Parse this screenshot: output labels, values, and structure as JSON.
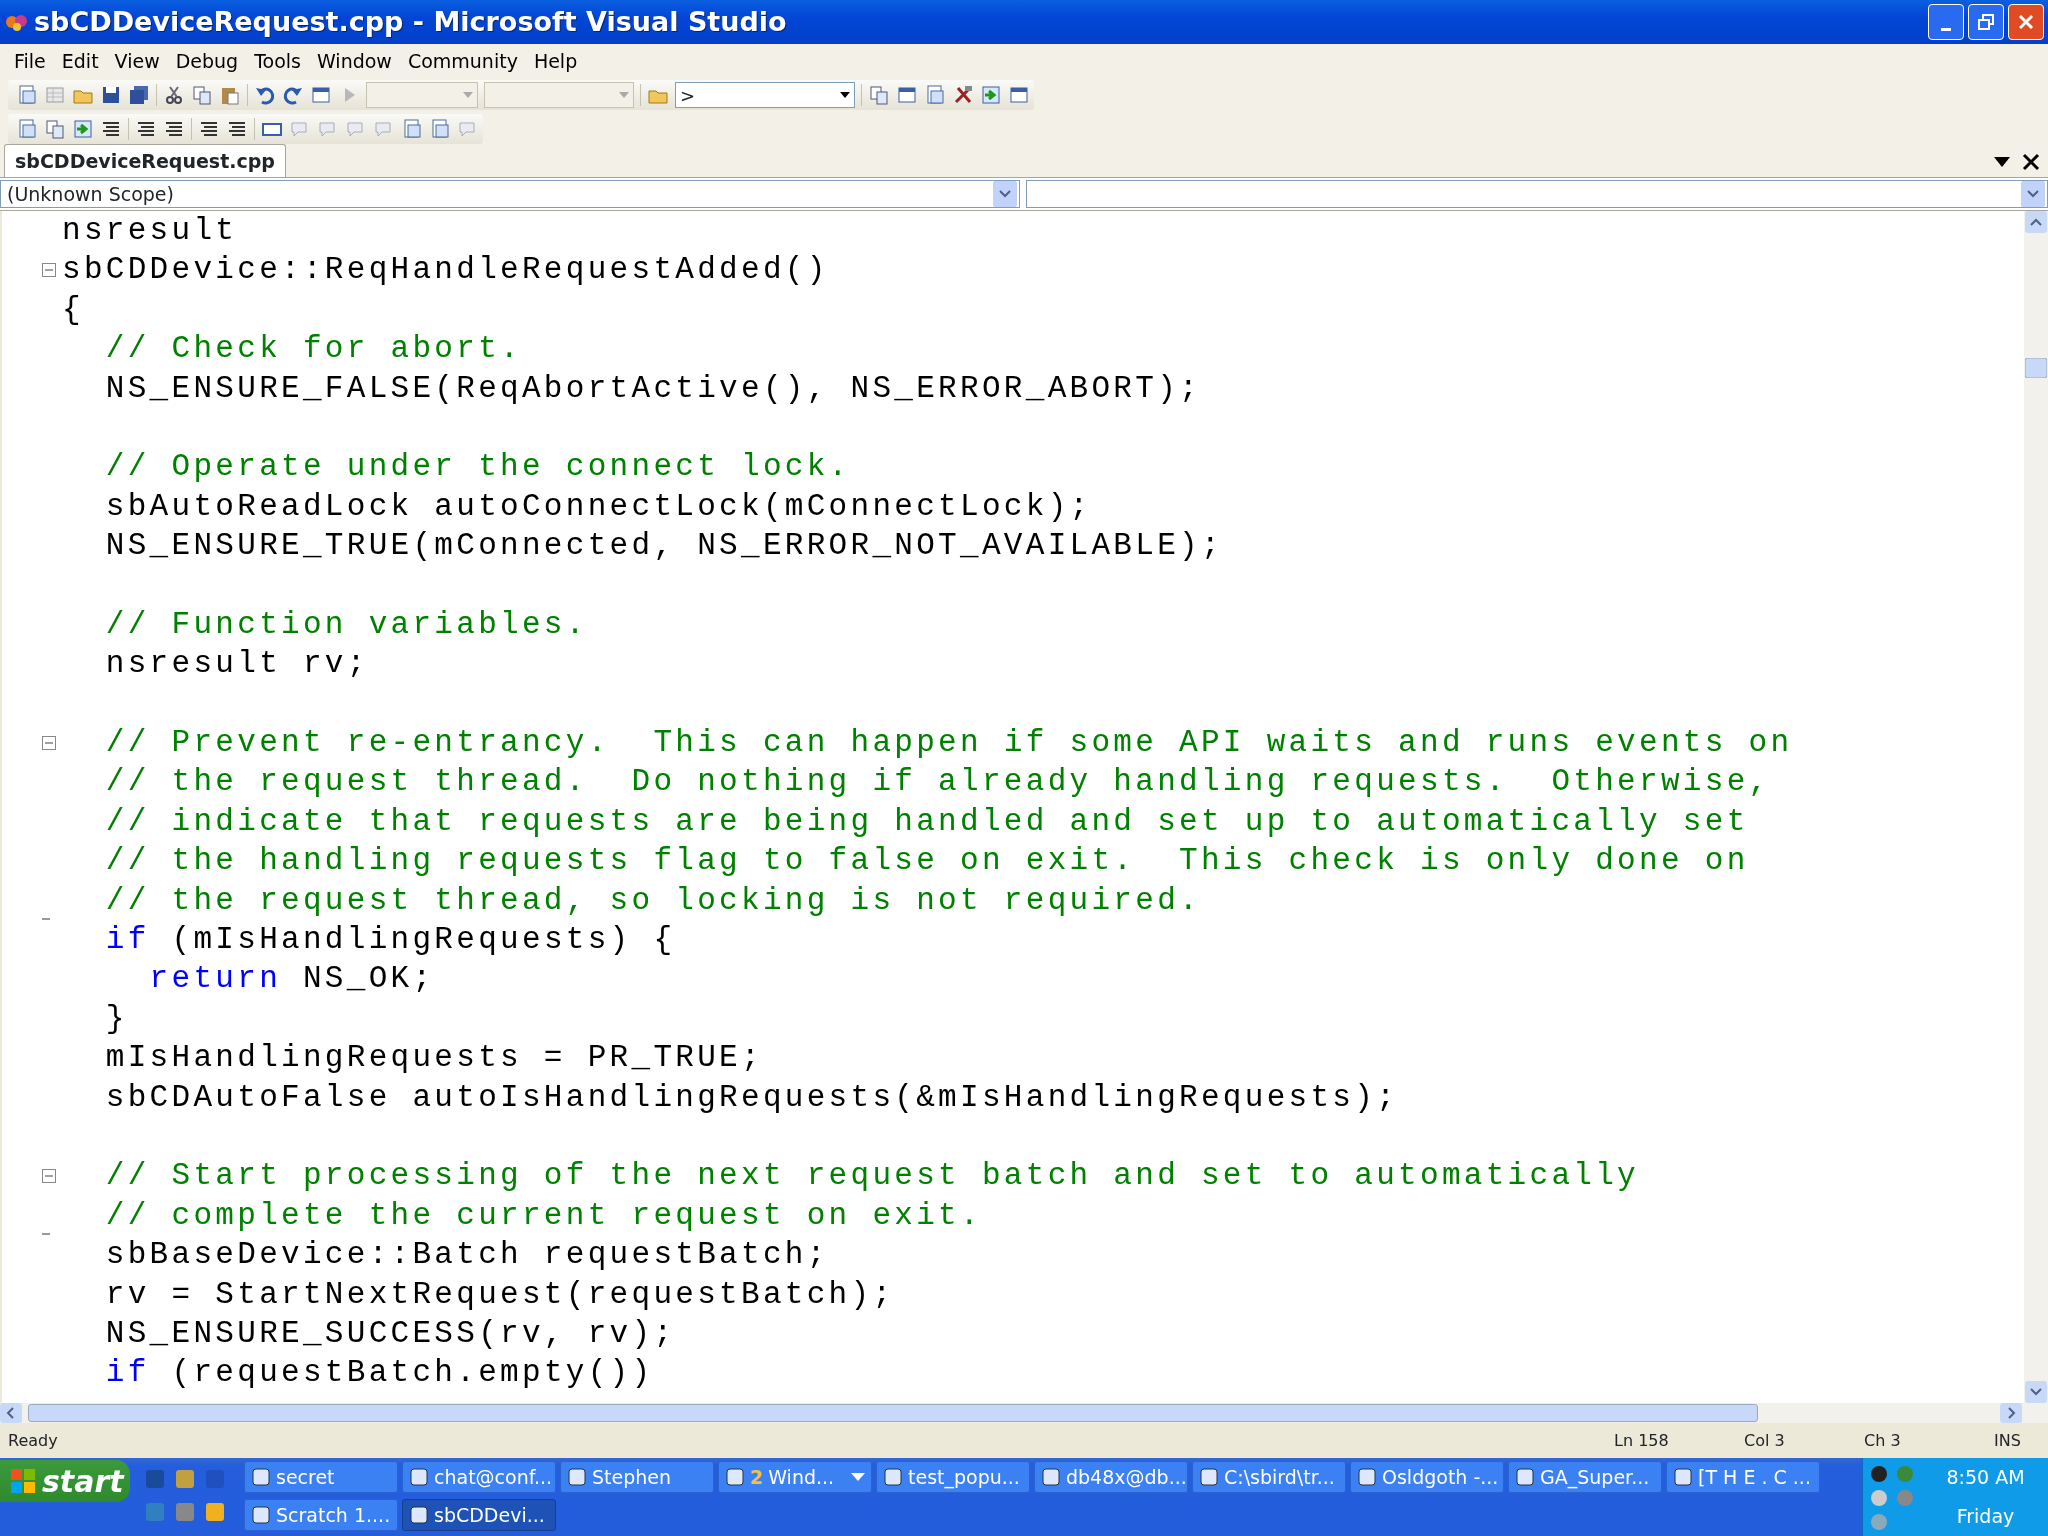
{
  "window": {
    "title": "sbCDDeviceRequest.cpp - Microsoft Visual Studio"
  },
  "menu": [
    "File",
    "Edit",
    "View",
    "Debug",
    "Tools",
    "Window",
    "Community",
    "Help"
  ],
  "toolbar": {
    "find_value": ">"
  },
  "document_tabs": [
    {
      "label": "sbCDDeviceRequest.cpp",
      "selected": true
    }
  ],
  "scope_bar": {
    "scope": "(Unknown Scope)"
  },
  "code_lines": [
    {
      "kind": "code",
      "parts": [
        {
          "kind": "plain",
          "text": "nsresult"
        }
      ]
    },
    {
      "kind": "code",
      "fold_start": true,
      "parts": [
        {
          "kind": "plain",
          "text": "sbCDDevice::ReqHandleRequestAdded()"
        }
      ]
    },
    {
      "kind": "code",
      "parts": [
        {
          "kind": "plain",
          "text": "{"
        }
      ]
    },
    {
      "kind": "code",
      "parts": [
        {
          "kind": "comment",
          "text": "  // Check for abort."
        }
      ]
    },
    {
      "kind": "code",
      "parts": [
        {
          "kind": "plain",
          "text": "  NS_ENSURE_FALSE(ReqAbortActive(), NS_ERROR_ABORT);"
        }
      ]
    },
    {
      "kind": "blank"
    },
    {
      "kind": "code",
      "parts": [
        {
          "kind": "comment",
          "text": "  // Operate under the connect lock."
        }
      ]
    },
    {
      "kind": "code",
      "parts": [
        {
          "kind": "plain",
          "text": "  sbAutoReadLock autoConnectLock(mConnectLock);"
        }
      ]
    },
    {
      "kind": "code",
      "parts": [
        {
          "kind": "plain",
          "text": "  NS_ENSURE_TRUE(mConnected, NS_ERROR_NOT_AVAILABLE);"
        }
      ]
    },
    {
      "kind": "blank"
    },
    {
      "kind": "code",
      "parts": [
        {
          "kind": "comment",
          "text": "  // Function variables."
        }
      ]
    },
    {
      "kind": "code",
      "parts": [
        {
          "kind": "plain",
          "text": "  nsresult rv;"
        }
      ]
    },
    {
      "kind": "blank"
    },
    {
      "kind": "code",
      "fold_start": true,
      "parts": [
        {
          "kind": "comment",
          "text": "  // Prevent re-entrancy.  This can happen if some API waits and runs events on"
        }
      ]
    },
    {
      "kind": "code",
      "parts": [
        {
          "kind": "comment",
          "text": "  // the request thread.  Do nothing if already handling requests.  Otherwise,"
        }
      ]
    },
    {
      "kind": "code",
      "parts": [
        {
          "kind": "comment",
          "text": "  // indicate that requests are being handled and set up to automatically set"
        }
      ]
    },
    {
      "kind": "code",
      "parts": [
        {
          "kind": "comment",
          "text": "  // the handling requests flag to false on exit.  This check is only done on"
        }
      ]
    },
    {
      "kind": "code",
      "fold_end": true,
      "parts": [
        {
          "kind": "comment",
          "text": "  // the request thread, so locking is not required."
        }
      ]
    },
    {
      "kind": "code",
      "parts": [
        {
          "kind": "keyword",
          "text": "  if"
        },
        {
          "kind": "plain",
          "text": " (mIsHandlingRequests) {"
        }
      ]
    },
    {
      "kind": "code",
      "parts": [
        {
          "kind": "keyword",
          "text": "    return"
        },
        {
          "kind": "plain",
          "text": " NS_OK;"
        }
      ]
    },
    {
      "kind": "code",
      "parts": [
        {
          "kind": "plain",
          "text": "  }"
        }
      ]
    },
    {
      "kind": "code",
      "parts": [
        {
          "kind": "plain",
          "text": "  mIsHandlingRequests = PR_TRUE;"
        }
      ]
    },
    {
      "kind": "code",
      "parts": [
        {
          "kind": "plain",
          "text": "  sbCDAutoFalse autoIsHandlingRequests(&mIsHandlingRequests);"
        }
      ]
    },
    {
      "kind": "blank"
    },
    {
      "kind": "code",
      "fold_start": true,
      "parts": [
        {
          "kind": "comment",
          "text": "  // Start processing of the next request batch and set to automatically"
        }
      ]
    },
    {
      "kind": "code",
      "fold_end": true,
      "parts": [
        {
          "kind": "comment",
          "text": "  // complete the current request on exit."
        }
      ]
    },
    {
      "kind": "code",
      "parts": [
        {
          "kind": "plain",
          "text": "  sbBaseDevice::Batch requestBatch;"
        }
      ]
    },
    {
      "kind": "code",
      "parts": [
        {
          "kind": "plain",
          "text": "  rv = StartNextRequest(requestBatch);"
        }
      ]
    },
    {
      "kind": "code",
      "parts": [
        {
          "kind": "plain",
          "text": "  NS_ENSURE_SUCCESS(rv, rv);"
        }
      ]
    },
    {
      "kind": "code",
      "parts": [
        {
          "kind": "keyword",
          "text": "  if"
        },
        {
          "kind": "plain",
          "text": " (requestBatch.empty())"
        }
      ]
    }
  ],
  "status_bar": {
    "message": "Ready",
    "line": "Ln 158",
    "column": "Col 3",
    "char": "Ch 3",
    "mode": "INS"
  },
  "taskbar": {
    "start": "start",
    "rows": [
      [
        {
          "label": "secret",
          "selected": false
        },
        {
          "label": "chat@conf...",
          "selected": false
        },
        {
          "label": "Stephen",
          "selected": false
        },
        {
          "count": "2",
          "label": "Wind...",
          "selected": false
        },
        {
          "label": "test_popu...",
          "selected": false
        },
        {
          "label": "db48x@db...",
          "selected": false
        },
        {
          "label": "C:\\sbird\\tr...",
          "selected": false
        },
        {
          "label": "Osldgoth -...",
          "selected": false
        },
        {
          "label": "GA_Super...",
          "selected": false
        },
        {
          "label": "[T H E . C ...",
          "selected": false
        }
      ],
      [
        {
          "label": "Scratch 1....",
          "selected": false
        },
        {
          "label": "sbCDDevi...",
          "selected": true
        }
      ]
    ],
    "clock": "8:50 AM",
    "day": "Friday"
  }
}
